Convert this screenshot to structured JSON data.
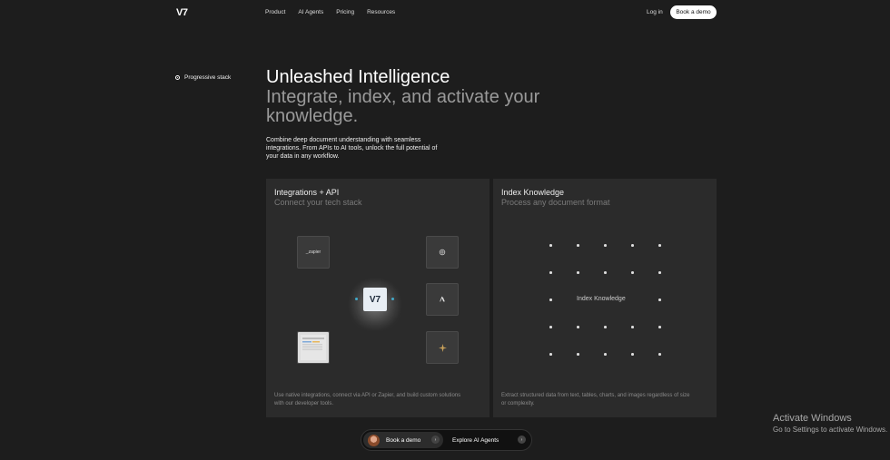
{
  "nav": {
    "logo": "V7",
    "links": [
      "Product",
      "AI Agents",
      "Pricing",
      "Resources"
    ],
    "login": "Log in",
    "book_demo": "Book a demo"
  },
  "side": {
    "label": "Progressive stack"
  },
  "hero": {
    "title": "Unleashed Intelligence",
    "subtitle": "Integrate, index, and activate your knowledge.",
    "description": "Combine deep document understanding with seamless integrations. From APIs to AI tools, unlock the full potential of your data in any workflow."
  },
  "cards": [
    {
      "title": "Integrations + API",
      "subtitle": "Connect your tech stack",
      "footer": "Use native integrations, connect via API or Zapier, and build custom solutions with our developer tools.",
      "tiles": {
        "zapier": "_zapier",
        "center": "V7"
      }
    },
    {
      "title": "Index Knowledge",
      "subtitle": "Process any document format",
      "center_label": "Index Knowledge",
      "footer": "Extract structured data from text, tables, charts, and images regardless of size or complexity."
    }
  ],
  "bottom_bar": {
    "book_demo": "Book a demo",
    "explore": "Explore AI Agents"
  },
  "watermark": {
    "title": "Activate Windows",
    "subtitle": "Go to Settings to activate Windows."
  }
}
